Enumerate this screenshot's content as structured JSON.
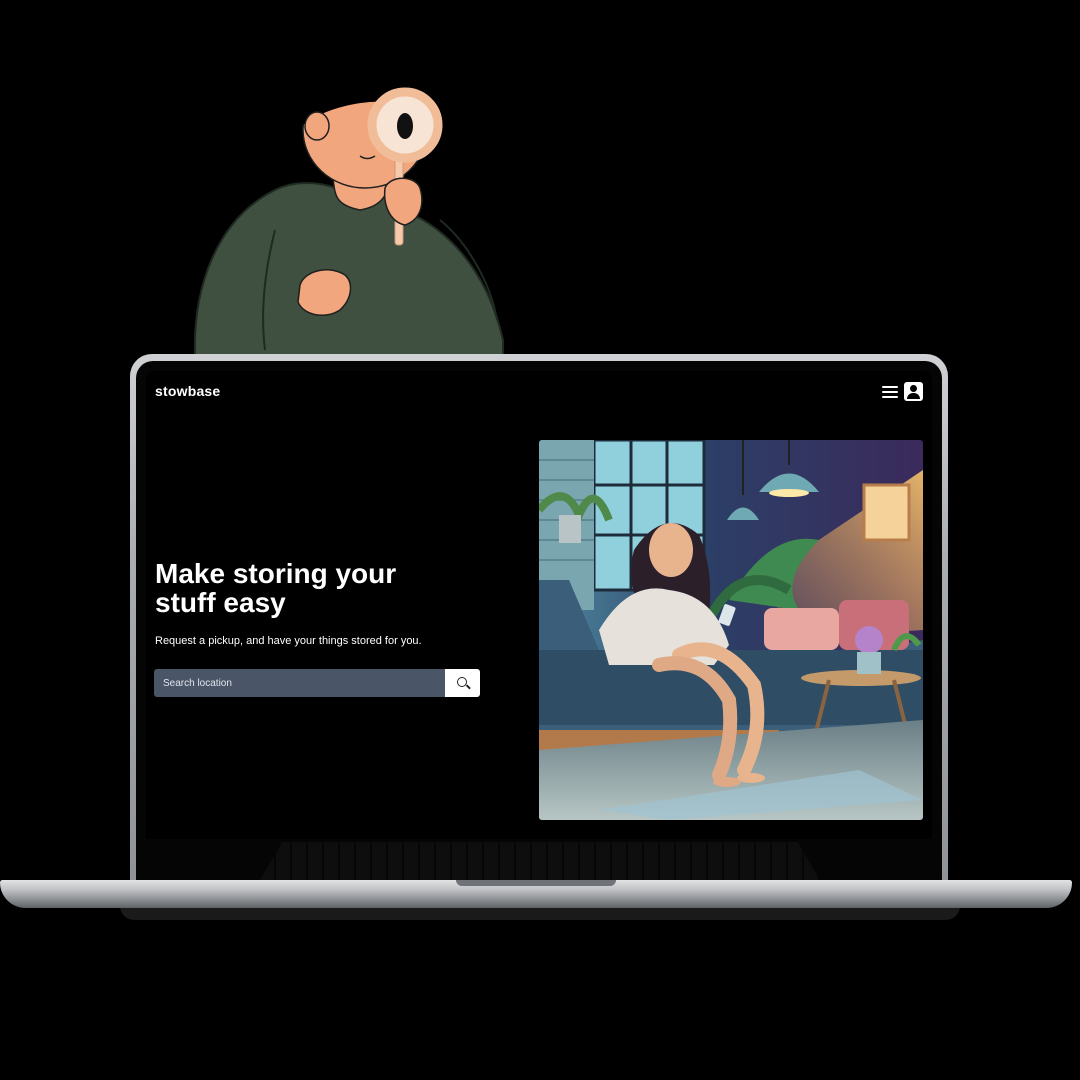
{
  "header": {
    "brand": "stowbase"
  },
  "hero": {
    "title": "Make storing your stuff easy",
    "subtitle": "Request a pickup, and have your things stored for you."
  },
  "search": {
    "placeholder": "Search location",
    "value": ""
  },
  "icons": {
    "menu": "hamburger-menu-icon",
    "account": "user-account-icon",
    "search": "search-icon",
    "illustration_magnifier": "magnifying-glass-icon"
  },
  "colors": {
    "page_background": "#000000",
    "search_field": "#4b5568",
    "sweater": "#3f4f40",
    "skin": "#f2a67e"
  }
}
